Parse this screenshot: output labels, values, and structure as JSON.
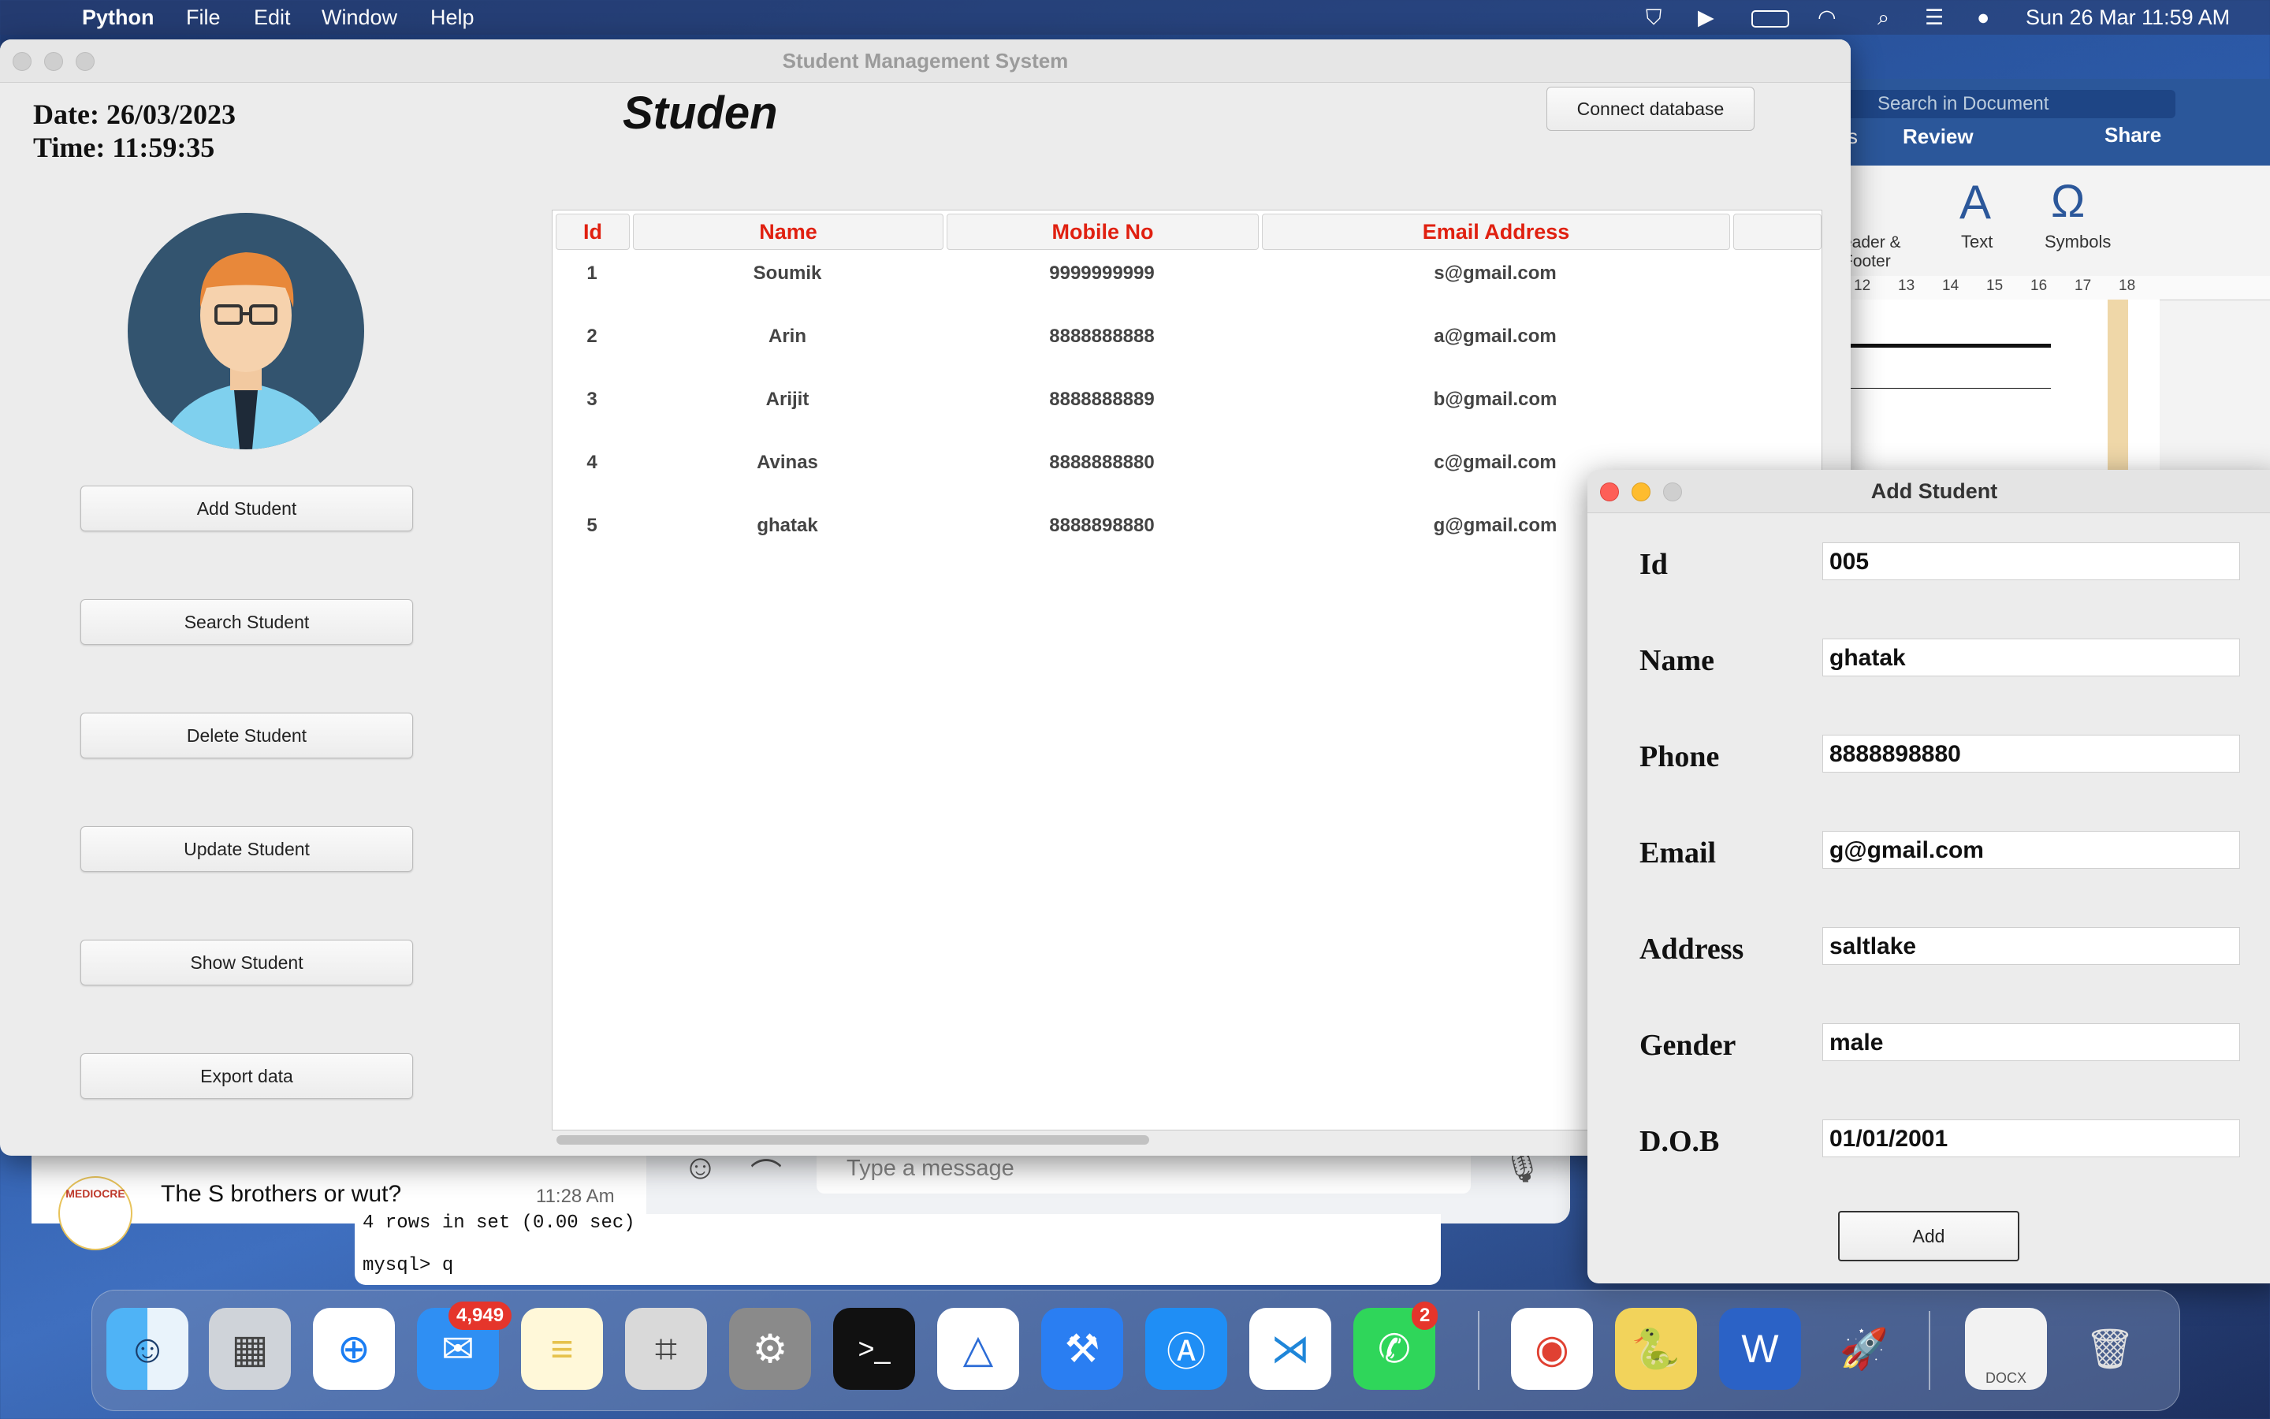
{
  "menubar": {
    "app_name": "Python",
    "items": [
      "File",
      "Edit",
      "Window",
      "Help"
    ],
    "datetime": "Sun 26 Mar  11:59 AM"
  },
  "main_window": {
    "title": "Student Management System",
    "date_label": "Date: 26/03/2023",
    "time_label": "Time: 11:59:35",
    "heading": "Studen",
    "connect_button": "Connect database",
    "side_buttons": [
      "Add Student",
      "Search Student",
      "Delete Student",
      "Update Student",
      "Show Student",
      "Export data"
    ],
    "table": {
      "headers": [
        "Id",
        "Name",
        "Mobile No",
        "Email Address"
      ],
      "rows": [
        [
          "1",
          "Soumik",
          "9999999999",
          "s@gmail.com"
        ],
        [
          "2",
          "Arin",
          "8888888888",
          "a@gmail.com"
        ],
        [
          "3",
          "Arijit",
          "8888888889",
          "b@gmail.com"
        ],
        [
          "4",
          "Avinas",
          "8888888880",
          "c@gmail.com"
        ],
        [
          "5",
          "ghatak",
          "8888898880",
          "g@gmail.com"
        ]
      ]
    }
  },
  "add_student": {
    "title": "Add Student",
    "fields": [
      {
        "label": "Id",
        "value": "005"
      },
      {
        "label": "Name",
        "value": "ghatak"
      },
      {
        "label": "Phone",
        "value": "8888898880"
      },
      {
        "label": "Email",
        "value": "g@gmail.com"
      },
      {
        "label": "Address",
        "value": "saltlake"
      },
      {
        "label": "Gender",
        "value": "male"
      },
      {
        "label": "D.O.B",
        "value": "01/01/2001"
      }
    ],
    "add_button": "Add"
  },
  "word": {
    "search_placeholder": "Search in Document",
    "tab_s": "s",
    "tab_review": "Review",
    "share": "Share",
    "header_footer": "eader &\nFooter",
    "text": "Text",
    "symbols": "Symbols",
    "ruler": [
      "12",
      "13",
      "14",
      "15",
      "16",
      "17",
      "18"
    ]
  },
  "whatsapp": {
    "chat_avatar_text": "MEDIOCRE",
    "chat_preview": "The S brothers or wut?",
    "chat_time": "11:28 Am",
    "message_placeholder": "Type a message"
  },
  "terminal": {
    "line1": "4 rows in set (0.00 sec)",
    "line2": "mysql> q"
  },
  "dock": {
    "mail_badge": "4,949",
    "whatsapp_badge": "2",
    "docx_label": "DOCX"
  }
}
